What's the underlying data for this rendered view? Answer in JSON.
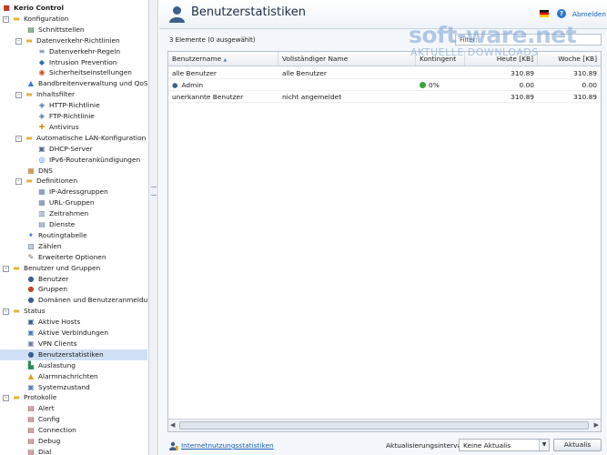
{
  "sidebar": {
    "items": [
      {
        "label": "Kerio Control",
        "level": 0,
        "icon": "kerio-logo-icon",
        "toggle": "",
        "root": true
      },
      {
        "label": "Konfiguration",
        "level": 0,
        "icon": "folder-icon",
        "toggle": "-"
      },
      {
        "label": "Schnittstellen",
        "level": 1,
        "icon": "network-interface-icon"
      },
      {
        "label": "Datenverkehr-Richtlinien",
        "level": 1,
        "icon": "folder-icon",
        "toggle": "-"
      },
      {
        "label": "Datenverkehr-Regeln",
        "level": 2,
        "icon": "traffic-rules-icon"
      },
      {
        "label": "Intrusion Prevention",
        "level": 2,
        "icon": "shield-icon"
      },
      {
        "label": "Sicherheitseinstellungen",
        "level": 2,
        "icon": "lifebuoy-icon"
      },
      {
        "label": "Bandbreitenverwaltung und QoS",
        "level": 1,
        "icon": "bandwidth-icon"
      },
      {
        "label": "Inhaltsfilter",
        "level": 1,
        "icon": "folder-icon",
        "toggle": "-"
      },
      {
        "label": "HTTP-Richtlinie",
        "level": 2,
        "icon": "http-policy-icon"
      },
      {
        "label": "FTP-Richtlinie",
        "level": 2,
        "icon": "ftp-policy-icon"
      },
      {
        "label": "Antivirus",
        "level": 2,
        "icon": "antivirus-icon"
      },
      {
        "label": "Automatische LAN-Konfiguration",
        "level": 1,
        "icon": "folder-icon",
        "toggle": "-"
      },
      {
        "label": "DHCP-Server",
        "level": 2,
        "icon": "dhcp-server-icon"
      },
      {
        "label": "IPv6-Routerankündigungen",
        "level": 2,
        "icon": "ipv6-icon"
      },
      {
        "label": "DNS",
        "level": 1,
        "icon": "dns-icon"
      },
      {
        "label": "Definitionen",
        "level": 1,
        "icon": "folder-icon",
        "toggle": "-"
      },
      {
        "label": "IP-Adressgruppen",
        "level": 2,
        "icon": "ip-groups-icon"
      },
      {
        "label": "URL-Gruppen",
        "level": 2,
        "icon": "url-groups-icon"
      },
      {
        "label": "Zeitrahmen",
        "level": 2,
        "icon": "calendar-icon"
      },
      {
        "label": "Dienste",
        "level": 2,
        "icon": "services-icon"
      },
      {
        "label": "Routingtabelle",
        "level": 1,
        "icon": "routing-icon"
      },
      {
        "label": "Zählen",
        "level": 1,
        "icon": "counter-icon"
      },
      {
        "label": "Erweiterte Optionen",
        "level": 1,
        "icon": "advanced-options-icon"
      },
      {
        "label": "Benutzer und Gruppen",
        "level": 0,
        "icon": "folder-icon",
        "toggle": "-"
      },
      {
        "label": "Benutzer",
        "level": 1,
        "icon": "user-icon"
      },
      {
        "label": "Gruppen",
        "level": 1,
        "icon": "group-icon"
      },
      {
        "label": "Domänen und Benutzeranmeldung",
        "level": 1,
        "icon": "domain-icon"
      },
      {
        "label": "Status",
        "level": 0,
        "icon": "folder-icon",
        "toggle": "-"
      },
      {
        "label": "Aktive Hosts",
        "level": 1,
        "icon": "hosts-icon"
      },
      {
        "label": "Aktive Verbindungen",
        "level": 1,
        "icon": "connections-icon"
      },
      {
        "label": "VPN Clients",
        "level": 1,
        "icon": "vpn-icon"
      },
      {
        "label": "Benutzerstatistiken",
        "level": 1,
        "icon": "user-stats-icon",
        "selected": true
      },
      {
        "label": "Auslastung",
        "level": 1,
        "icon": "load-icon"
      },
      {
        "label": "Alarmnachrichten",
        "level": 1,
        "icon": "warning-icon"
      },
      {
        "label": "Systemzustand",
        "level": 1,
        "icon": "system-health-icon"
      },
      {
        "label": "Protokolle",
        "level": 0,
        "icon": "folder-icon",
        "toggle": "-"
      },
      {
        "label": "Alert",
        "level": 1,
        "icon": "log-icon"
      },
      {
        "label": "Config",
        "level": 1,
        "icon": "log-icon"
      },
      {
        "label": "Connection",
        "level": 1,
        "icon": "log-icon"
      },
      {
        "label": "Debug",
        "level": 1,
        "icon": "log-icon"
      },
      {
        "label": "Dial",
        "level": 1,
        "icon": "log-icon"
      }
    ]
  },
  "header": {
    "title": "Benutzerstatistiken",
    "icon": "user-stats-icon",
    "logout": "Abmelden"
  },
  "toolbar": {
    "items_count": "3 Elemente (0 ausgewählt)",
    "filter_label": "Filter:"
  },
  "grid": {
    "columns": [
      "Benutzername",
      "Vollständiger Name",
      "Kontingent",
      "Heute [KB]",
      "Woche [KB]"
    ],
    "sort_indicator": "▲",
    "rows": [
      {
        "user": "alle Benutzer",
        "fullname": "alle Benutzer",
        "quota": "",
        "quota_status": "",
        "today": "310.89",
        "week": "310.89",
        "icon": ""
      },
      {
        "user": "Admin",
        "fullname": "",
        "quota": "0%",
        "quota_status": "#3aa63a",
        "today": "0.00",
        "week": "0.00",
        "icon": "user-icon"
      },
      {
        "user": "unerkannte Benutzer",
        "fullname": "nicht angemeldet",
        "quota": "",
        "quota_status": "",
        "today": "310.89",
        "week": "310.89",
        "icon": ""
      }
    ]
  },
  "footer": {
    "stats_link": "Internetnutzungsstatistiken",
    "interval_label": "Aktualisierungsintervall:",
    "interval_value": "Keine Aktualis",
    "refresh": "Aktualis"
  },
  "watermark": {
    "main": "soft-ware.net",
    "sub": "AKTUELLE DOWNLOADS"
  },
  "colors": {
    "accent": "#1a5fb4",
    "selection": "#cfe0f5",
    "quota_ok": "#3aa63a"
  }
}
